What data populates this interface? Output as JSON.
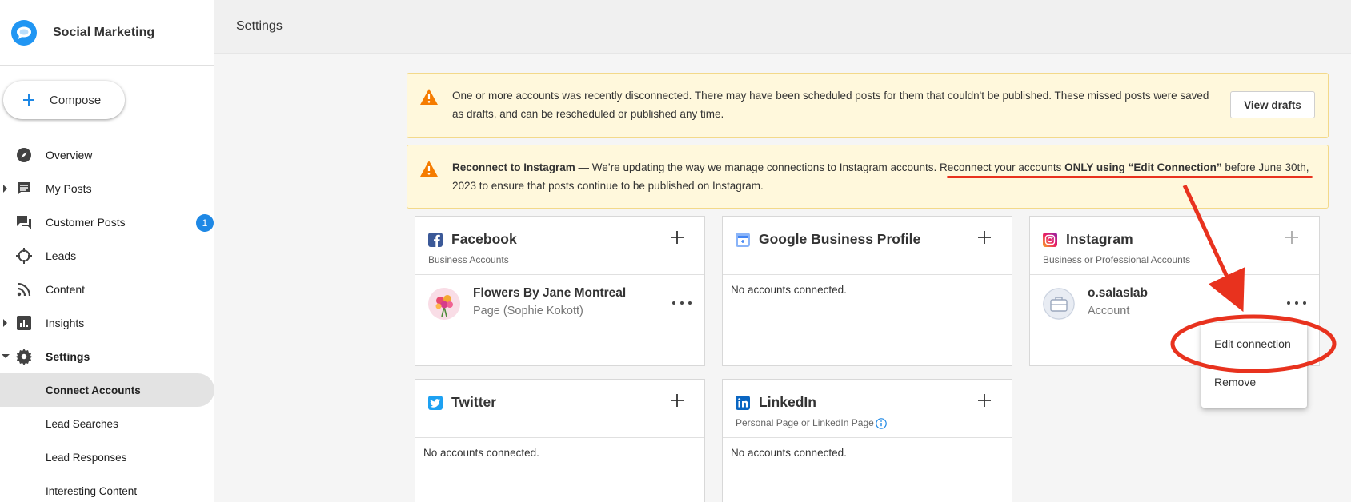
{
  "app": {
    "name": "Social Marketing"
  },
  "compose": {
    "label": "Compose"
  },
  "nav": {
    "items": [
      {
        "label": "Overview"
      },
      {
        "label": "My Posts"
      },
      {
        "label": "Customer Posts",
        "badge": "1"
      },
      {
        "label": "Leads"
      },
      {
        "label": "Content"
      },
      {
        "label": "Insights"
      },
      {
        "label": "Settings"
      }
    ],
    "settings_sub": [
      {
        "label": "Connect Accounts"
      },
      {
        "label": "Lead Searches"
      },
      {
        "label": "Lead Responses"
      },
      {
        "label": "Interesting Content"
      }
    ]
  },
  "header": {
    "title": "Settings"
  },
  "alerts": {
    "disconnected": {
      "text": "One or more accounts was recently disconnected. There may have been scheduled posts for them that couldn't be published. These missed posts were saved as drafts, and can be rescheduled or published any time.",
      "button": "View drafts"
    },
    "instagram": {
      "title": "Reconnect to Instagram",
      "dash": " — We’re updating the way we manage connections to Instagram accounts. ",
      "part1": "Reconnect your accounts ",
      "emph": "ONLY using “Edit Connection”",
      "part2": " before June 30th, 2023 to ensure that posts continue to be published on Instagram."
    }
  },
  "cards": {
    "facebook": {
      "title": "Facebook",
      "subtitle": "Business Accounts",
      "account_name": "Flowers By Jane Montreal",
      "account_type": "Page (Sophie Kokott)"
    },
    "google": {
      "title": "Google Business Profile",
      "empty": "No accounts connected."
    },
    "instagram": {
      "title": "Instagram",
      "subtitle": "Business or Professional Accounts",
      "account_name": "o.salaslab",
      "account_type": "Account"
    },
    "twitter": {
      "title": "Twitter",
      "empty": "No accounts connected."
    },
    "linkedin": {
      "title": "LinkedIn",
      "subtitle": "Personal Page or LinkedIn Page",
      "empty": "No accounts connected."
    }
  },
  "menu": {
    "edit": "Edit connection",
    "remove": "Remove"
  },
  "colors": {
    "accent": "#1e88e5",
    "warning": "#f57c00",
    "annotation": "#e8321e",
    "facebook": "#3b5998",
    "twitter": "#1da1f2",
    "linkedin": "#0a66c2"
  }
}
